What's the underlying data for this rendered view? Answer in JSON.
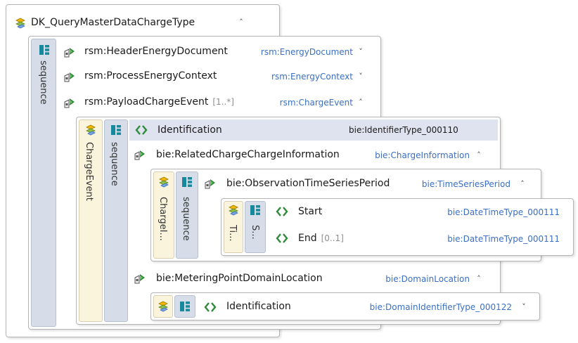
{
  "root": {
    "title": "DK_QueryMasterDataChargeType",
    "collapse": "˄"
  },
  "outer": {
    "compositor": "sequence",
    "elements": [
      {
        "name": "rsm:HeaderEnergyDocument",
        "type": "rsm:EnergyDocument",
        "chevron": "˅"
      },
      {
        "name": "rsm:ProcessEnergyContext",
        "type": "rsm:EnergyContext",
        "chevron": "˅"
      },
      {
        "name": "rsm:PayloadChargeEvent",
        "cardinality": "[1..*]",
        "type": "rsm:ChargeEvent",
        "chevron": "˄"
      }
    ]
  },
  "charge_event": {
    "type_label": "ChargeEvent",
    "compositor": "sequence",
    "identification": {
      "name": "Identification",
      "type": "bie:IdentifierType_000110"
    },
    "related": {
      "name": "bie:RelatedChargeChargeInformation",
      "type": "bie:ChargeInformation",
      "chevron": "˄"
    },
    "metering": {
      "name": "bie:MeteringPointDomainLocation",
      "type": "bie:DomainLocation",
      "chevron": "˄"
    }
  },
  "charge_info": {
    "type_label": "ChargeI...",
    "compositor": "sequence",
    "observation": {
      "name": "bie:ObservationTimeSeriesPeriod",
      "type": "bie:TimeSeriesPeriod",
      "chevron": "˄"
    }
  },
  "period": {
    "type_label": "Ti...",
    "compositor": "S...",
    "start": {
      "name": "Start",
      "type": "bie:DateTimeType_000111"
    },
    "end": {
      "name": "End",
      "cardinality": "[0..1]",
      "type": "bie:DateTimeType_000111"
    }
  },
  "location": {
    "identification": {
      "name": "Identification",
      "type": "bie:DomainIdentifierType_000122",
      "chevron": "˅"
    }
  },
  "colors": {
    "type_blue": "#3a6fc4",
    "sequence_band": "#d6dde8",
    "choice_band": "#fbf4dc",
    "icon_orange": "#e0a200",
    "icon_green": "#2e8b3a",
    "icon_teal": "#168a9c"
  }
}
